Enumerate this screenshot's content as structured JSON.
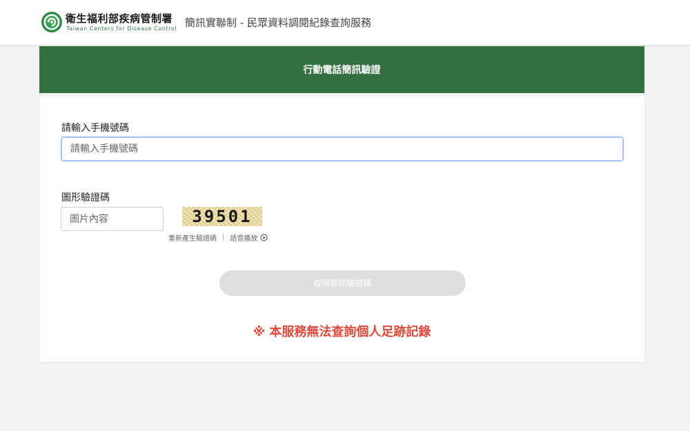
{
  "header": {
    "org_name": "衛生福利部疾病管制署",
    "org_name_en": "Taiwan Centers for Disease Control",
    "site_title": "簡訊實聯制 - 民眾資料調閱紀錄查詢服務"
  },
  "panel": {
    "title": "行動電話簡訊驗證"
  },
  "form": {
    "phone_label": "請輸入手機號碼",
    "phone_placeholder": "請輸入手機號碼",
    "phone_value": "",
    "captcha_label": "圖形驗證碼",
    "captcha_placeholder": "圖片內容",
    "captcha_value": "",
    "captcha_image_text": "39501",
    "regenerate_link": "重新產生驗證碼",
    "links_separator": "|",
    "audio_link": "語音播放",
    "submit_label": "取得簡訊驗證碼"
  },
  "notice": {
    "text": "※ 本服務無法查詢個人足跡記錄"
  },
  "colors": {
    "brand_green": "#32703f",
    "notice_red": "#e04a3a",
    "button_disabled": "#dedede"
  },
  "icons": {
    "logo": "cdc-logo-icon",
    "audio": "play-circle-icon"
  }
}
